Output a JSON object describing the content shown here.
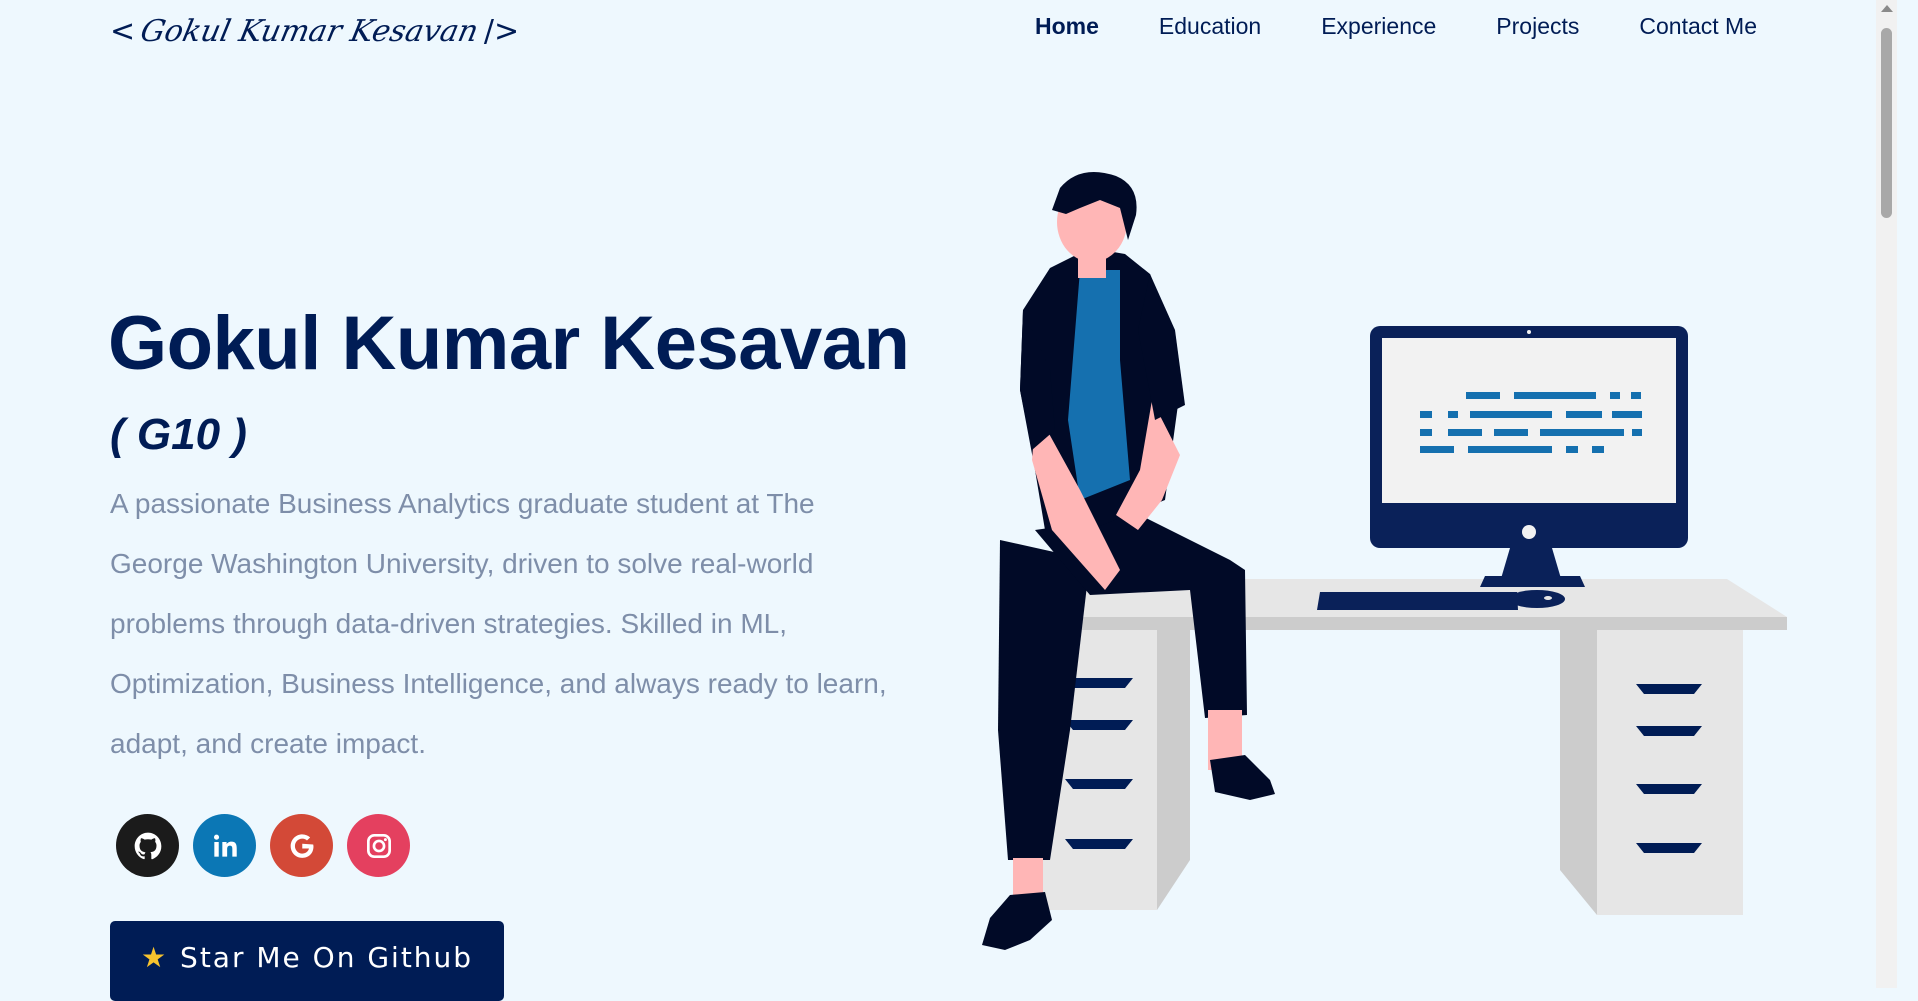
{
  "header": {
    "logo_open": "<",
    "logo_signature": "Gokul Kumar Kesavan",
    "logo_close": "/>",
    "nav": [
      {
        "label": "Home",
        "active": true
      },
      {
        "label": "Education",
        "active": false
      },
      {
        "label": "Experience",
        "active": false
      },
      {
        "label": "Projects",
        "active": false
      },
      {
        "label": "Contact Me",
        "active": false
      }
    ]
  },
  "hero": {
    "name": "Gokul Kumar Kesavan",
    "tag": "( G10 )",
    "description": "A passionate Business Analytics graduate student at The George Washington University, driven to solve real-world problems through data-driven strategies. Skilled in ML, Optimization, Business Intelligence, and always ready to learn, adapt, and create impact.",
    "socials": [
      {
        "name": "github-icon",
        "color": "#1b1b1b"
      },
      {
        "name": "linkedin-icon",
        "color": "#0b77b5"
      },
      {
        "name": "google-icon",
        "color": "#d34937"
      },
      {
        "name": "instagram-icon",
        "color": "#e4405f"
      }
    ],
    "cta_label": "Star Me On Github",
    "cta_icon": "star-icon"
  },
  "colors": {
    "background": "#eef8fe",
    "primary": "#001c55",
    "text_muted": "#7e8ea9",
    "accent_blue": "#1570af"
  }
}
